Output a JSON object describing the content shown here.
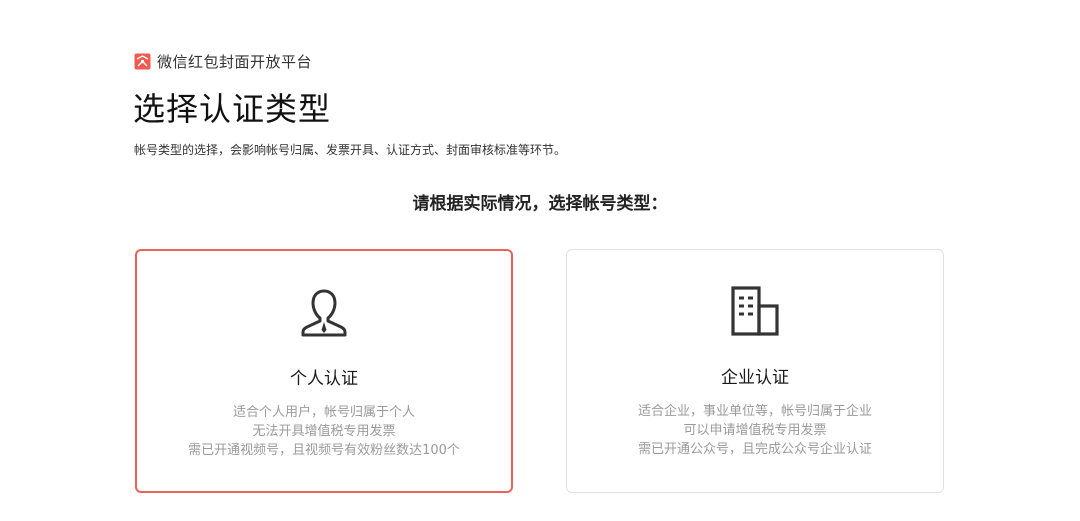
{
  "header": {
    "brand_name": "微信红包封面开放平台",
    "brand_icon": "red-envelope-icon",
    "brand_color": "#f25a4f"
  },
  "main": {
    "title": "选择认证类型",
    "description": "帐号类型的选择，会影响帐号归属、发票开具、认证方式、封面审核标准等环节。",
    "prompt": "请根据实际情况，选择帐号类型："
  },
  "cards": [
    {
      "title": "个人认证",
      "icon": "person-icon",
      "selected": true,
      "lines": [
        "适合个人用户，帐号归属于个人",
        "无法开具增值税专用发票",
        "需已开通视频号，且视频号有效粉丝数达100个"
      ]
    },
    {
      "title": "企业认证",
      "icon": "building-icon",
      "selected": false,
      "lines": [
        "适合企业，事业单位等，帐号归属于企业",
        "可以申请增值税专用发票",
        "需已开通公众号，且完成公众号企业认证"
      ]
    }
  ],
  "colors": {
    "selected_border": "#e8635a",
    "default_border": "#e2e2e2",
    "muted_text": "#9a9a9a"
  }
}
